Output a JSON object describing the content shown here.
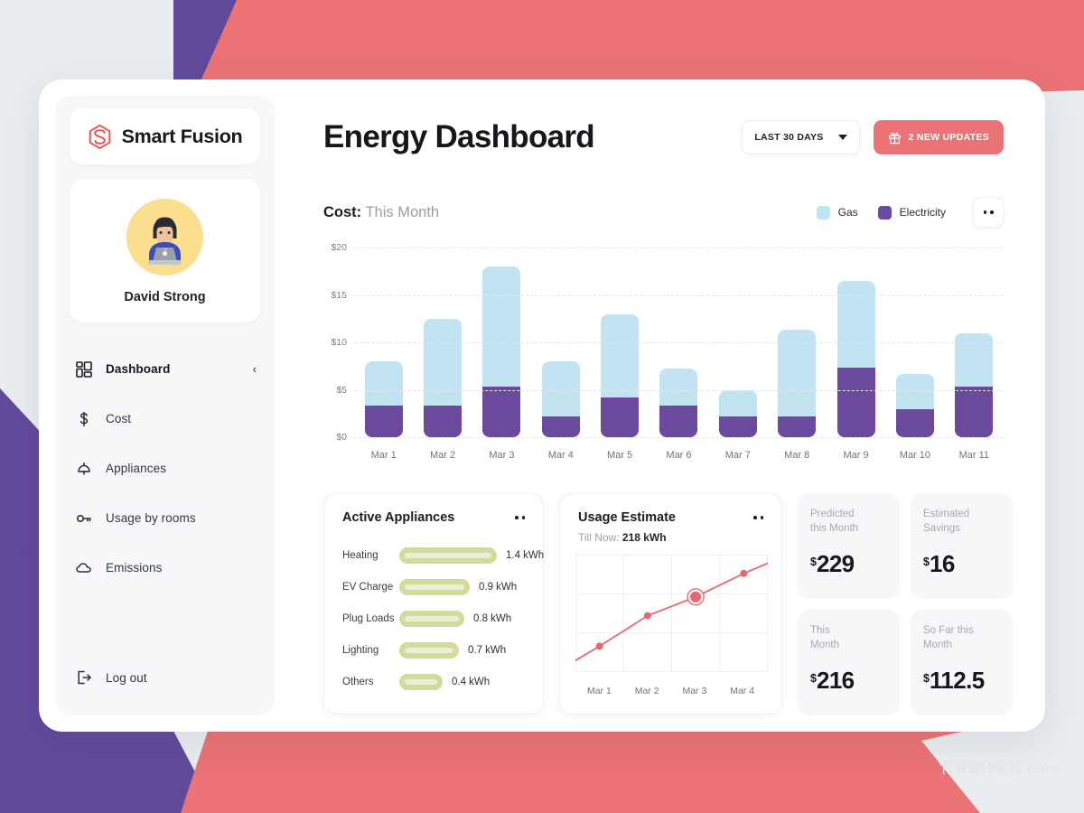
{
  "brand": {
    "name": "Smart Fusion",
    "logo_icon": "hexagon-s-logo-icon"
  },
  "profile": {
    "name": "David Strong",
    "avatar_icon": "user-avatar-laptop"
  },
  "sidebar": {
    "items": [
      {
        "label": "Dashboard",
        "icon": "grid-dashboard-icon",
        "active": true,
        "chevron": "‹"
      },
      {
        "label": "Cost",
        "icon": "dollar-icon",
        "active": false
      },
      {
        "label": "Appliances",
        "icon": "lamp-icon",
        "active": false
      },
      {
        "label": "Usage by rooms",
        "icon": "key-icon",
        "active": false
      },
      {
        "label": "Emissions",
        "icon": "cloud-icon",
        "active": false
      }
    ],
    "logout": {
      "label": "Log out",
      "icon": "logout-icon"
    }
  },
  "header": {
    "title": "Energy Dashboard",
    "range_select": {
      "label": "LAST 30 DAYS",
      "icon": "chevron-down-icon"
    },
    "updates_button": {
      "label": "2 NEW UPDATES",
      "icon": "gift-icon"
    }
  },
  "cost_section": {
    "title_bold": "Cost:",
    "title_rest": "This Month",
    "menu_icon": "more-options-icon",
    "legend": [
      {
        "label": "Gas",
        "color": "#c2e3f1"
      },
      {
        "label": "Electricity",
        "color": "#6b4a9e"
      }
    ]
  },
  "chart_data": [
    {
      "type": "bar",
      "title": "Cost: This Month",
      "stacked": true,
      "xlabel": "",
      "ylabel": "",
      "ylim": [
        0,
        20
      ],
      "yticks": [
        "$0",
        "$5",
        "$10",
        "$15",
        "$20"
      ],
      "ytick_values": [
        0,
        5,
        10,
        15,
        20
      ],
      "grid": true,
      "legend_position": "top-right",
      "categories": [
        "Mar 1",
        "Mar 2",
        "Mar 3",
        "Mar 4",
        "Mar 5",
        "Mar 6",
        "Mar 7",
        "Mar 8",
        "Mar 9",
        "Mar 10",
        "Mar 11"
      ],
      "series": [
        {
          "name": "Electricity",
          "color": "#6b4a9e",
          "values": [
            3.3,
            3.3,
            5.3,
            2.2,
            4.2,
            3.3,
            2.2,
            2.2,
            7.3,
            3.0,
            5.3
          ]
        },
        {
          "name": "Gas",
          "color": "#c2e3f1",
          "values": [
            4.7,
            9.2,
            12.7,
            5.8,
            8.8,
            3.9,
            2.8,
            9.1,
            9.2,
            3.7,
            5.7
          ]
        }
      ],
      "totals": [
        8.0,
        12.5,
        18.0,
        8.0,
        13.0,
        7.2,
        5.0,
        11.3,
        16.5,
        6.7,
        11.0
      ]
    },
    {
      "type": "line",
      "title": "Usage Estimate",
      "subtitle_label": "Till Now:",
      "subtitle_value": "218 kWh",
      "grid": true,
      "x": [
        "Mar 1",
        "Mar 2",
        "Mar 3",
        "Mar 4"
      ],
      "values": [
        22,
        48,
        64,
        84
      ],
      "ylim": [
        0,
        100
      ],
      "color": "#e8676c",
      "highlight_index": 2
    }
  ],
  "appliances_panel": {
    "title": "Active Appliances",
    "menu_icon": "more-options-icon",
    "bar_color": "#cfdc9c",
    "rows": [
      {
        "name": "Heating",
        "value": "1.4 kWh",
        "amount": 1.4
      },
      {
        "name": "EV Charge",
        "value": "0.9 kWh",
        "amount": 0.9
      },
      {
        "name": "Plug Loads",
        "value": "0.8 kWh",
        "amount": 0.8
      },
      {
        "name": "Lighting",
        "value": "0.7 kWh",
        "amount": 0.7
      },
      {
        "name": "Others",
        "value": "0.4 kWh",
        "amount": 0.4
      }
    ]
  },
  "usage_panel": {
    "title": "Usage Estimate",
    "menu_icon": "more-options-icon",
    "subtitle_label": "Till Now: ",
    "subtitle_value": "218 kWh",
    "x_labels": [
      "Mar 1",
      "Mar 2",
      "Mar 3",
      "Mar 4"
    ]
  },
  "stats": [
    {
      "label": "Predicted\nthis Month",
      "currency": "$",
      "value": "229"
    },
    {
      "label": "Estimated\nSavings",
      "currency": "$",
      "value": "16"
    },
    {
      "label": "This\nMonth",
      "currency": "$",
      "value": "216"
    },
    {
      "label": "So Far this\nMonth",
      "currency": "$",
      "value": "112.5"
    }
  ],
  "watermark": "TOOOPEN.com",
  "colors": {
    "page_bg": "#e9edf0",
    "purple": "#6a4a9e",
    "coral": "#eb7375",
    "gas": "#c2e3f1",
    "electricity": "#6b4a9e",
    "appliance_green": "#cfdc9c"
  }
}
